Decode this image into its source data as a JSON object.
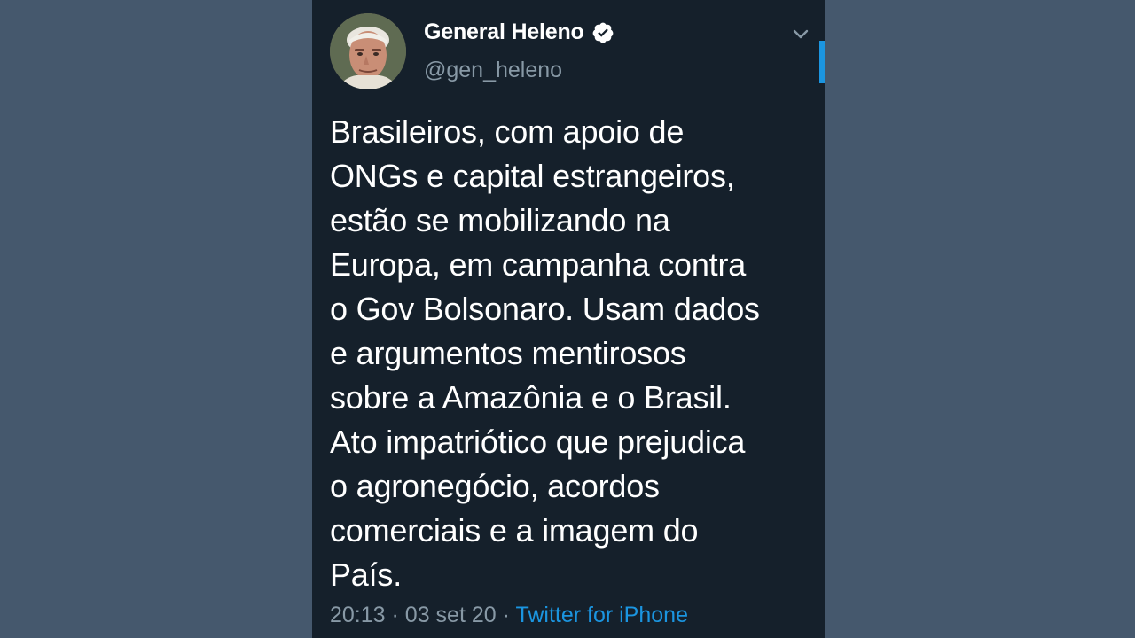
{
  "tweet": {
    "author": {
      "display_name": "General Heleno",
      "handle": "@gen_heleno",
      "verified_icon": "verified-badge-icon"
    },
    "text": "Brasileiros, com apoio de\nONGs e capital estrangeiros,\nestão se mobilizando na\nEuropa, em campanha contra\no Gov Bolsonaro. Usam dados\ne argumentos mentirosos\nsobre a Amazônia e o Brasil.\nAto impatriótico que prejudica\no agronegócio, acordos\ncomerciais e a imagem do\nPaís.",
    "time": "20:13",
    "separator": "·",
    "date": "03 set 20",
    "source": "Twitter for iPhone"
  },
  "icons": {
    "menu": "chevron-down-icon"
  },
  "colors": {
    "page_background": "#45586d",
    "tweet_background": "#15202b",
    "primary_text": "#ffffff",
    "secondary_text": "#8899a6",
    "accent": "#1b95e0"
  }
}
